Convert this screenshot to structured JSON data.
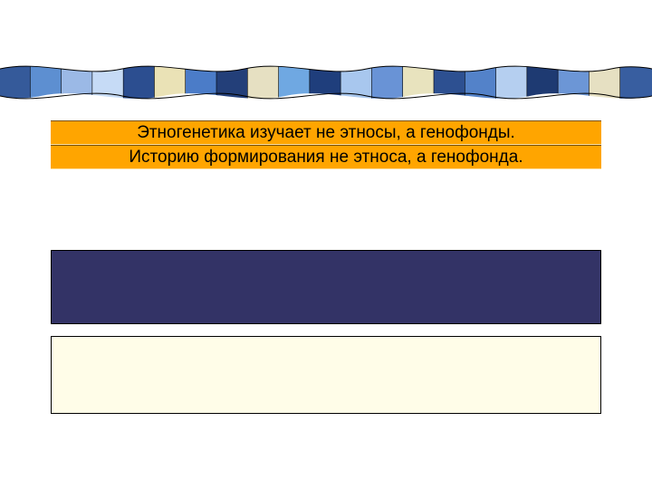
{
  "title_line_1": "Этногенетика изучает не этносы, а генофонды.",
  "title_line_2": "Историю формирования не этноса, а генофонда.",
  "ribbon_colors": [
    "#355a9a",
    "#5d8fd1",
    "#9bb9e6",
    "#c6dbf6",
    "#2c4e90",
    "#eae2b6",
    "#4b7cc8",
    "#233f79",
    "#e6e0c2",
    "#6fa8e2",
    "#1f3e7c",
    "#a8c7ee",
    "#6993d6",
    "#e8e3be",
    "#2d5091",
    "#5382c9",
    "#b5cff0",
    "#1e3a72",
    "#6c96d6",
    "#e6e0c2",
    "#385ea0"
  ]
}
